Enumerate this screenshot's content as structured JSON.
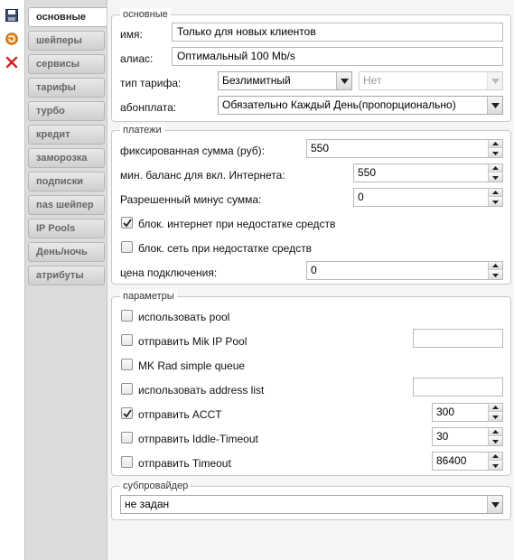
{
  "toolbar": {
    "icons": [
      "save-icon",
      "refresh-icon",
      "close-icon"
    ]
  },
  "tabs": [
    {
      "label": "основные",
      "active": true
    },
    {
      "label": "шейперы"
    },
    {
      "label": "сервисы"
    },
    {
      "label": "тарифы"
    },
    {
      "label": "турбо"
    },
    {
      "label": "кредит"
    },
    {
      "label": "заморозка"
    },
    {
      "label": "подписки"
    },
    {
      "label": "nas шейпер"
    },
    {
      "label": "IP Pools"
    },
    {
      "label": "День/ночь"
    },
    {
      "label": "атрибуты"
    }
  ],
  "basic": {
    "legend": "основные",
    "name_label": "имя:",
    "name_value": "Только для новых клиентов",
    "alias_label": "алиас:",
    "alias_value": "Оптимальный 100 Mb/s",
    "tariff_type_label": "тип тарифа:",
    "tariff_type_value": "Безлимитный",
    "tariff_type_extra": "Нет",
    "fee_label": "абонплата:",
    "fee_value": "Обязательно Каждый День(пропорционально)"
  },
  "payments": {
    "legend": "платежи",
    "fixed_sum_label": "фиксированная сумма (руб):",
    "fixed_sum_value": "550",
    "min_balance_label": "мин. баланс для вкл. Интернета:",
    "min_balance_value": "550",
    "allowed_minus_label": "Разрешенный минус сумма:",
    "allowed_minus_value": "0",
    "block_internet_label": "блок. интернет при недостатке средств",
    "block_internet_checked": true,
    "block_network_label": "блок. сеть при недостатке средств",
    "block_network_checked": false,
    "connect_price_label": "цена подключения:",
    "connect_price_value": "0"
  },
  "params": {
    "legend": "параметры",
    "use_pool_label": "использовать pool",
    "use_pool_checked": false,
    "send_mik_pool_label": "отправить Mik IP Pool",
    "send_mik_pool_checked": false,
    "mik_pool_value": "",
    "mk_rad_label": "MK Rad simple queue",
    "mk_rad_checked": false,
    "use_address_list_label": "использовать address list",
    "use_address_list_checked": false,
    "address_list_value": "",
    "send_acct_label": "отправить ACCT",
    "send_acct_checked": true,
    "acct_value": "300",
    "send_idle_label": "отправить Iddle-Timeout",
    "send_idle_checked": false,
    "idle_value": "30",
    "send_timeout_label": "отправить Timeout",
    "send_timeout_checked": false,
    "timeout_value": "86400"
  },
  "subprovider": {
    "legend": "субпровайдер",
    "value": "не задан"
  }
}
